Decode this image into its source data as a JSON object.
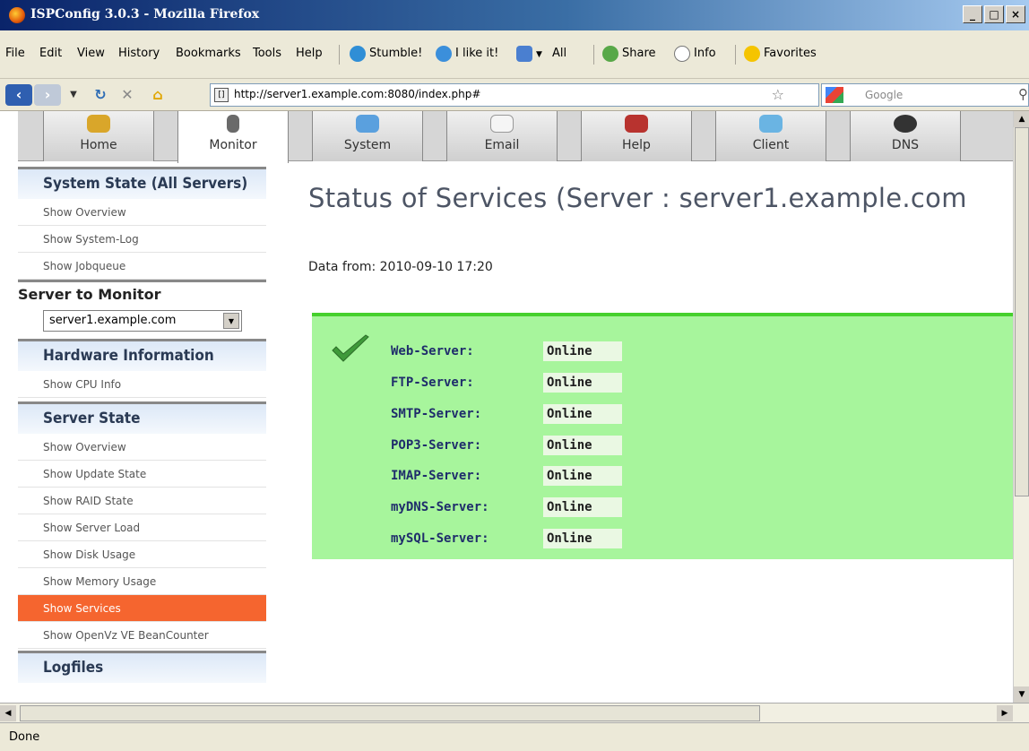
{
  "window": {
    "title": "ISPConfig 3.0.3 - Mozilla Firefox"
  },
  "menu": {
    "items": [
      "File",
      "Edit",
      "View",
      "History",
      "Bookmarks",
      "Tools",
      "Help"
    ],
    "toolbar": {
      "stumble": "Stumble!",
      "ilike": "I like it!",
      "all": "All",
      "share": "Share",
      "info": "Info",
      "favorites": "Favorites"
    }
  },
  "nav": {
    "url": "http://server1.example.com:8080/index.php#",
    "search_placeholder": "Google"
  },
  "tabs": [
    {
      "label": "Home",
      "icon": "home-icon"
    },
    {
      "label": "Monitor",
      "icon": "monitor-icon"
    },
    {
      "label": "System",
      "icon": "system-icon"
    },
    {
      "label": "Email",
      "icon": "email-icon"
    },
    {
      "label": "Help",
      "icon": "help-icon"
    },
    {
      "label": "Client",
      "icon": "client-icon"
    },
    {
      "label": "DNS",
      "icon": "dns-icon"
    }
  ],
  "sidebar": {
    "system_state": {
      "heading": "System State (All Servers)",
      "items": [
        "Show Overview",
        "Show System-Log",
        "Show Jobqueue"
      ]
    },
    "server_to_monitor": {
      "label": "Server to Monitor",
      "selected": "server1.example.com"
    },
    "hardware": {
      "heading": "Hardware Information",
      "items": [
        "Show CPU Info"
      ]
    },
    "server_state": {
      "heading": "Server State",
      "items": [
        "Show Overview",
        "Show Update State",
        "Show RAID State",
        "Show Server Load",
        "Show Disk Usage",
        "Show Memory Usage",
        "Show Services",
        "Show OpenVz VE BeanCounter"
      ],
      "active_index": 6
    },
    "logfiles": {
      "heading": "Logfiles"
    }
  },
  "main": {
    "title": "Status of Services (Server : server1.example.com",
    "data_from": "Data from: 2010-09-10 17:20",
    "services": [
      {
        "name": "Web-Server:",
        "status": "Online"
      },
      {
        "name": "FTP-Server:",
        "status": "Online"
      },
      {
        "name": "SMTP-Server:",
        "status": "Online"
      },
      {
        "name": "POP3-Server:",
        "status": "Online"
      },
      {
        "name": "IMAP-Server:",
        "status": "Online"
      },
      {
        "name": "myDNS-Server:",
        "status": "Online"
      },
      {
        "name": "mySQL-Server:",
        "status": "Online"
      }
    ]
  },
  "status_bar": {
    "text": "Done"
  },
  "colors": {
    "accent": "#f5652f",
    "status_bg": "#a7f59c",
    "status_border": "#45d02c",
    "title_text": "#4d5565"
  }
}
